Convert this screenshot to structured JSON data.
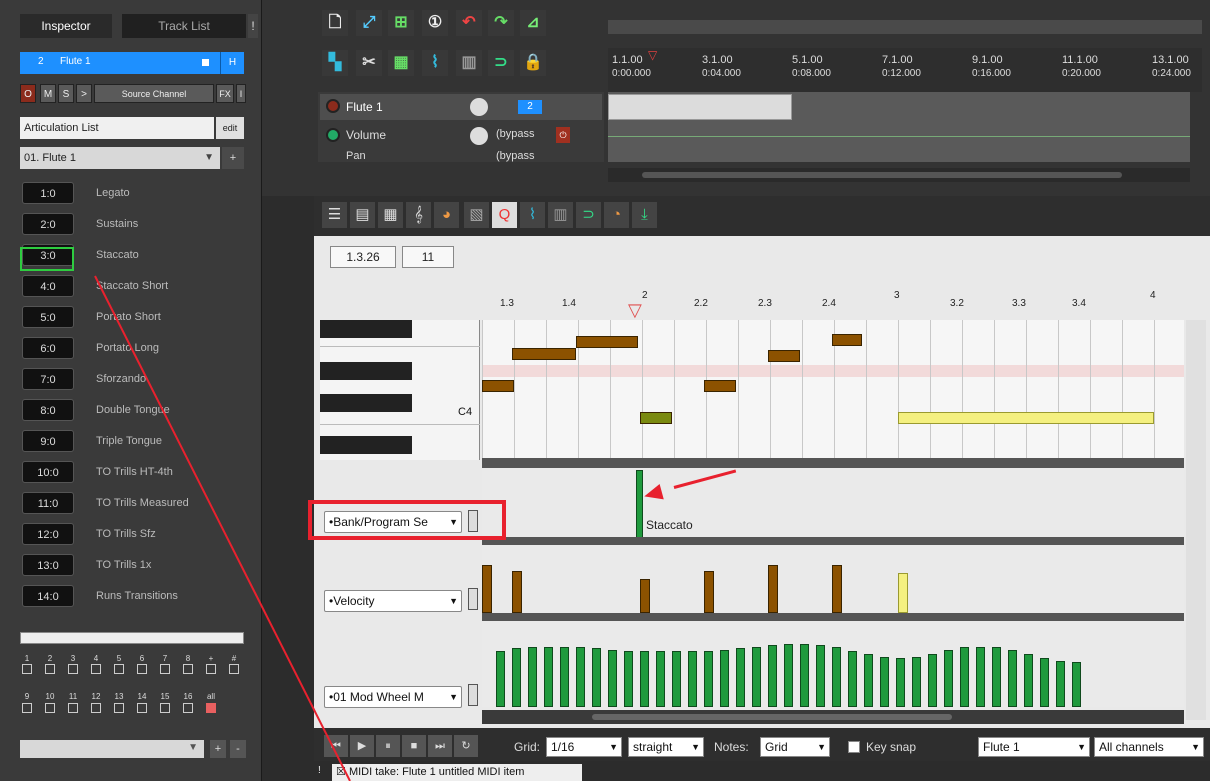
{
  "inspector": {
    "tab_inspector": "Inspector",
    "tab_tracklist": "Track List",
    "tab_extra": "!",
    "track_num": "2",
    "track_name": "Flute 1",
    "track_h": "H",
    "btn_o": "O",
    "btn_m": "M",
    "btn_s": "S",
    "btn_gt": ">",
    "source_channel": "Source Channel",
    "fx": "FX",
    "fx_i": "I",
    "articulation_list": "Articulation List",
    "edit": "edit",
    "preset": "01. Flute 1",
    "plus": "+",
    "articulations": [
      {
        "id": "1:0",
        "label": "Legato"
      },
      {
        "id": "2:0",
        "label": "Sustains"
      },
      {
        "id": "3:0",
        "label": "Staccato"
      },
      {
        "id": "4:0",
        "label": "Staccato Short"
      },
      {
        "id": "5:0",
        "label": "Portato Short"
      },
      {
        "id": "6:0",
        "label": "Portato Long"
      },
      {
        "id": "7:0",
        "label": "Sforzando"
      },
      {
        "id": "8:0",
        "label": "Double Tongue"
      },
      {
        "id": "9:0",
        "label": "Triple Tongue"
      },
      {
        "id": "10:0",
        "label": "TO Trills HT-4th"
      },
      {
        "id": "11:0",
        "label": "TO Trills Measured"
      },
      {
        "id": "12:0",
        "label": "TO Trills Sfz"
      },
      {
        "id": "13:0",
        "label": "TO Trills 1x"
      },
      {
        "id": "14:0",
        "label": "Runs Transitions"
      }
    ],
    "channels_row1": [
      "1",
      "2",
      "3",
      "4",
      "5",
      "6",
      "7",
      "8",
      "+",
      "#"
    ],
    "channels_row2": [
      "9",
      "10",
      "11",
      "12",
      "13",
      "14",
      "15",
      "16",
      "all"
    ],
    "bottom_plus": "+",
    "bottom_minus": "-"
  },
  "arrange": {
    "ruler_marks": [
      {
        "bar": "1.1.00",
        "time": "0:00.000"
      },
      {
        "bar": "3.1.00",
        "time": "0:04.000"
      },
      {
        "bar": "5.1.00",
        "time": "0:08.000"
      },
      {
        "bar": "7.1.00",
        "time": "0:12.000"
      },
      {
        "bar": "9.1.00",
        "time": "0:16.000"
      },
      {
        "bar": "11.1.00",
        "time": "0:20.000"
      },
      {
        "bar": "13.1.00",
        "time": "0:24.000"
      }
    ],
    "track_flute": "Flute 1",
    "track_flute_num": "2",
    "track_volume": "Volume",
    "track_volume_val": "(bypass",
    "track_pan": "Pan",
    "track_pan_val": "(bypass"
  },
  "midi": {
    "position": "1.3.26",
    "length": "11",
    "ruler": [
      "1.3",
      "1.4",
      "2",
      "2.2",
      "2.3",
      "2.4",
      "3",
      "3.2",
      "3.3",
      "3.4",
      "4"
    ],
    "c4_label": "C4",
    "lanes": {
      "bank": "•Bank/Program Se",
      "velocity": "•Velocity",
      "mod": "•01 Mod Wheel M"
    },
    "staccato_label": "Staccato",
    "grid_label": "Grid:",
    "grid_val": "1/16",
    "straight": "straight",
    "notes_label": "Notes:",
    "notes_val": "Grid",
    "key_snap": "Key snap",
    "track_sel": "Flute 1",
    "channels_sel": "All channels",
    "mod_values": [
      0.8,
      0.84,
      0.86,
      0.86,
      0.86,
      0.86,
      0.84,
      0.82,
      0.8,
      0.8,
      0.8,
      0.8,
      0.8,
      0.8,
      0.82,
      0.84,
      0.86,
      0.88,
      0.9,
      0.9,
      0.88,
      0.86,
      0.8,
      0.76,
      0.72,
      0.7,
      0.72,
      0.76,
      0.82,
      0.86,
      0.86,
      0.86,
      0.82,
      0.76,
      0.7,
      0.66,
      0.64
    ]
  },
  "status": {
    "excl": "!",
    "checkbox": "☒",
    "text": "MIDI take: Flute 1 untitled MIDI item"
  },
  "colors": {
    "accent": "#1e90ff",
    "annotation": "#e8212e",
    "note": "#8c5200",
    "cc": "#1f9a3d",
    "selected_note": "#f4f080"
  }
}
